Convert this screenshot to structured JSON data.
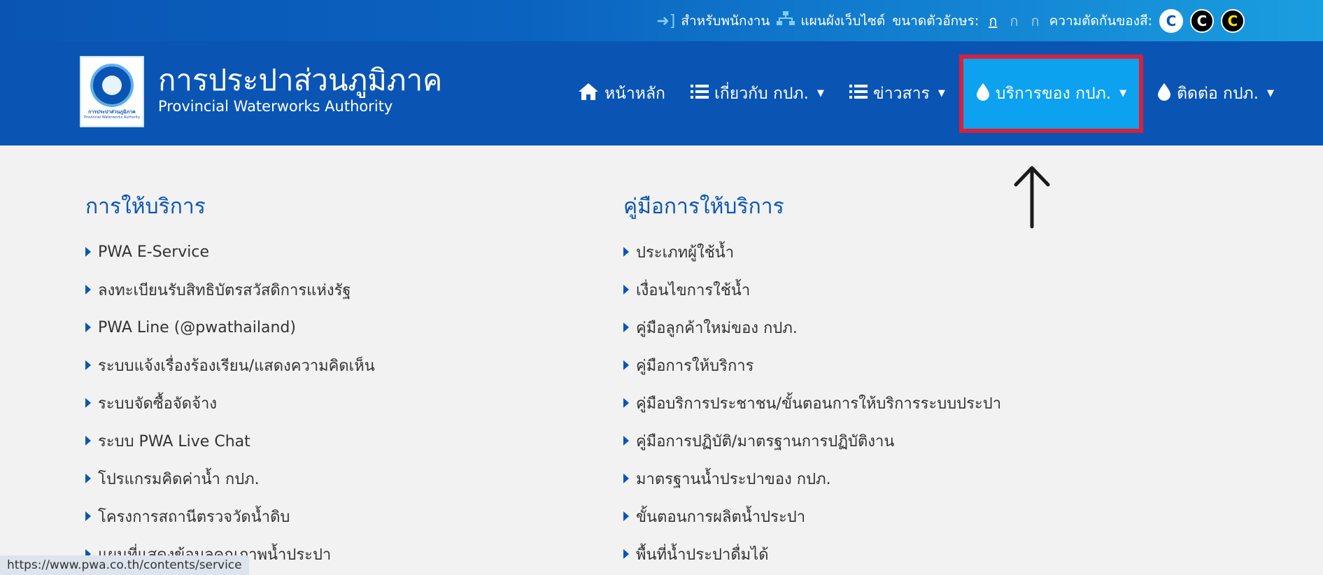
{
  "topbar": {
    "staff_label": "สำหรับพนักงาน",
    "sitemap_label": "แผนผังเว็บไซต์",
    "font_size_label": "ขนาดตัวอักษร:",
    "font_sizes": [
      "ก",
      "ก",
      "ก"
    ],
    "contrast_label": "ความตัดกันของสี:",
    "contrast_options": [
      "C",
      "C",
      "C"
    ]
  },
  "brand": {
    "name_th": "การประปาส่วนภูมิภาค",
    "name_en": "Provincial Waterworks Authority",
    "logo_text_th": "การประปาส่วนภูมิภาค",
    "logo_text_en": "Provincial Waterworks Authority"
  },
  "nav": {
    "home": "หน้าหลัก",
    "about": "เกี่ยวกับ กปภ.",
    "news": "ข่าวสาร",
    "services": "บริการของ กปภ.",
    "contact": "ติดต่อ กปภ."
  },
  "menu": {
    "left_title": "การให้บริการ",
    "left_items": [
      "PWA E-Service",
      "ลงทะเบียนรับสิทธิบัตรสวัสดิการแห่งรัฐ",
      "PWA Line (@pwathailand)",
      "ระบบแจ้งเรื่องร้องเรียน/แสดงความคิดเห็น",
      "ระบบจัดซื้อจัดจ้าง",
      "ระบบ PWA Live Chat",
      "โปรแกรมคิดค่าน้ำ กปภ.",
      "โครงการสถานีตรวจวัดน้ำดิบ",
      "แผนที่แสดงข้อมูลคุณภาพน้ำประปา"
    ],
    "right_title": "คู่มือการให้บริการ",
    "right_items": [
      "ประเภทผู้ใช้น้ำ",
      "เงื่อนไขการใช้น้ำ",
      "คู่มือลูกค้าใหม่ของ กปภ.",
      "คู่มือการให้บริการ",
      "คู่มือบริการประชาชน/ขั้นตอนการให้บริการระบบประปา",
      "คู่มือการปฏิบัติ/มาตรฐานการปฏิบัติงาน",
      "มาตรฐานน้ำประปาของ กปภ.",
      "ขั้นตอนการผลิตน้ำประปา",
      "พื้นที่น้ำประปาดื่มได้"
    ]
  },
  "status_url": "https://www.pwa.co.th/contents/service",
  "colors": {
    "primary": "#0a55b4",
    "active": "#0ca2f0",
    "highlight": "#d8203a"
  }
}
